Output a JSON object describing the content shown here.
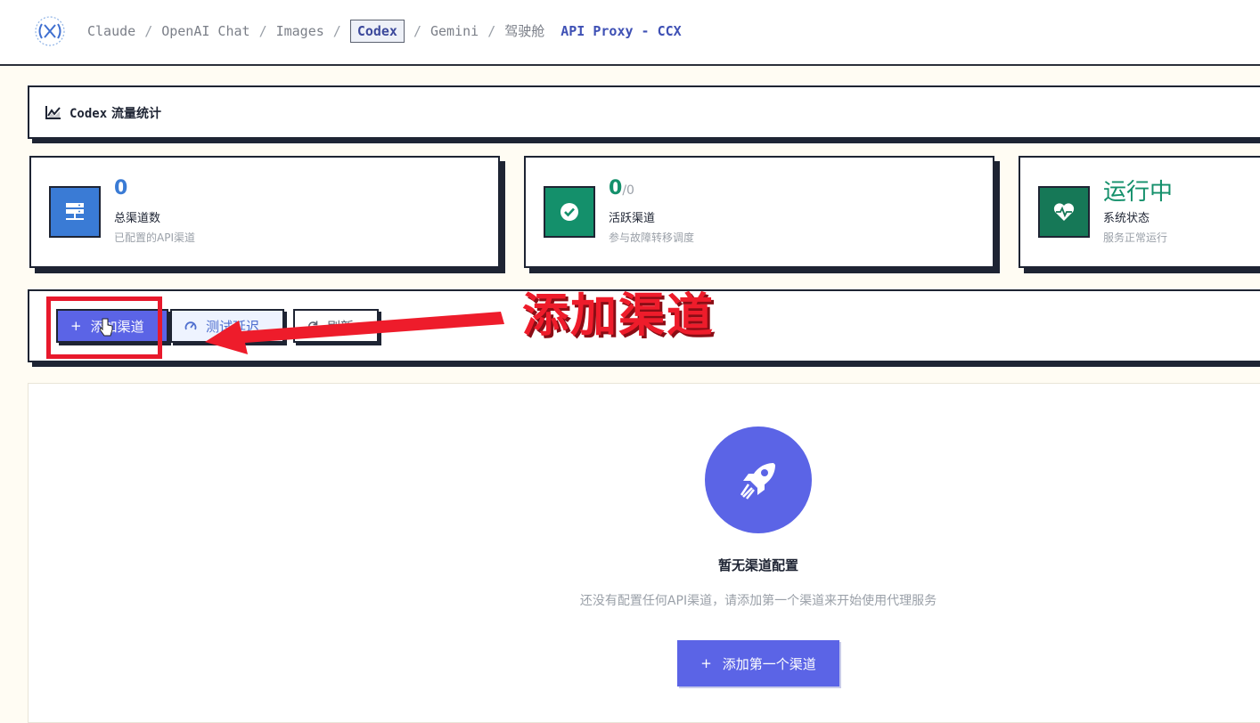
{
  "nav": {
    "crumbs": [
      "Claude",
      "OpenAI Chat",
      "Images",
      "Codex",
      "Gemini",
      "驾驶舱"
    ],
    "separator": "/",
    "active": "Codex",
    "brand": "API Proxy - CCX"
  },
  "stats_header": {
    "codex": "Codex",
    "title": "流量统计"
  },
  "cards": [
    {
      "value": "0",
      "suffix": "",
      "name": "总渠道数",
      "desc": "已配置的API渠道",
      "icon": "server-icon",
      "value_color": "#3a7bd5",
      "icon_bg": "#3a7bd5"
    },
    {
      "value": "0",
      "suffix": "/0",
      "name": "活跃渠道",
      "desc": "参与故障转移调度",
      "icon": "check-circle-icon",
      "value_color": "#14906b",
      "icon_bg": "#14906b"
    },
    {
      "value": "运行中",
      "suffix": "",
      "name": "系统状态",
      "desc": "服务正常运行",
      "icon": "heart-pulse-icon",
      "value_color": "#14906b",
      "icon_bg": "#167857"
    }
  ],
  "toolbar": {
    "add_label": "添加渠道",
    "latency_label": "测试延迟",
    "refresh_label": "刷新"
  },
  "annotation": {
    "text": "添加渠道",
    "color": "#ee1c2b"
  },
  "empty": {
    "title": "暂无渠道配置",
    "subtitle": "还没有配置任何API渠道，请添加第一个渠道来开始使用代理服务",
    "button_label": "添加第一个渠道",
    "icon": "rocket-icon"
  },
  "colors": {
    "accent": "#5b64e6",
    "background": "#fffcf3",
    "border": "#1e2433"
  }
}
